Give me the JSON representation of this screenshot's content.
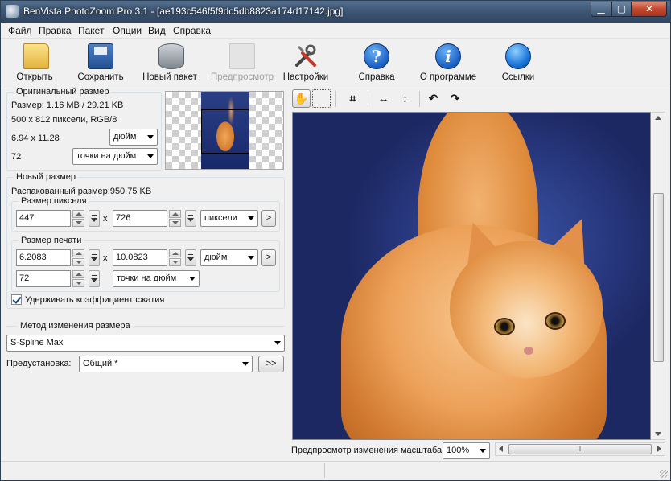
{
  "window": {
    "title": "BenVista PhotoZoom Pro 3.1 - [ae193c546f5f9dc5db8823a174d17142.jpg]"
  },
  "menu": [
    "Файл",
    "Правка",
    "Пакет",
    "Опции",
    "Вид",
    "Справка"
  ],
  "toolbar": {
    "open": "Открыть",
    "save": "Сохранить",
    "batch": "Новый пакет",
    "preview": "Предпросмотр",
    "settings": "Настройки",
    "help": "Справка",
    "about": "О программе",
    "links": "Ссылки"
  },
  "original": {
    "title": "Оригинальный размер",
    "size": "Размер: 1.16 MB / 29.21 KB",
    "pixels": "500 x 812 пиксели, RGB/8",
    "dims": "6.94 x 11.28",
    "dims_unit": "дюйм",
    "res": "72",
    "res_unit": "точки на дюйм"
  },
  "newsize": {
    "title": "Новый размер",
    "unpacked": "Распакованный размер:950.75 KB",
    "pixel_group": "Размер пикселя",
    "width_px": "447",
    "height_px": "726",
    "px_unit": "пиксели",
    "x": "x",
    "print_group": "Размер печати",
    "width_in": "6.2083",
    "height_in": "10.0823",
    "in_unit": "дюйм",
    "res": "72",
    "res_unit": "точки на дюйм",
    "arrow": ">",
    "keep_ratio": "Удерживать коэффициент сжатия"
  },
  "method": {
    "title": "Метод изменения размера",
    "value": "S-Spline Max",
    "preset_label": "Предустановка:",
    "preset_value": "Общий *",
    "preset_btn": ">>"
  },
  "view": {
    "zoom_label": "Предпросмотр изменения масштаба:",
    "zoom_value": "100%",
    "hscroll_grip": "III"
  }
}
